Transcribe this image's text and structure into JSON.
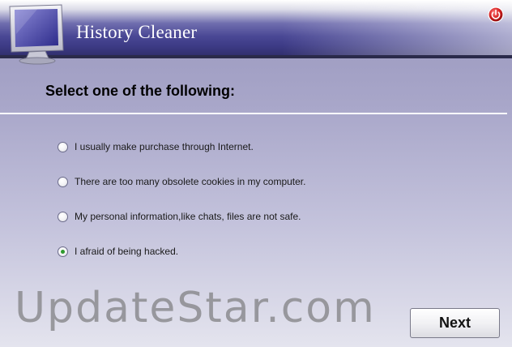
{
  "window": {
    "title": "History Cleaner"
  },
  "icons": {
    "app_icon": "monitor-icon",
    "close_icon": "power-icon"
  },
  "question": {
    "instruction": "Select one of the following:",
    "options": [
      {
        "label": "I usually make purchase through Internet.",
        "selected": false
      },
      {
        "label": "There are too many obsolete cookies in my computer.",
        "selected": false
      },
      {
        "label": "My personal information,like chats, files are not safe.",
        "selected": false
      },
      {
        "label": "I afraid of being hacked.",
        "selected": true
      }
    ]
  },
  "watermark": "UpdateStar.com",
  "footer": {
    "next_label": "Next"
  },
  "colors": {
    "title_bar": "#4a4895",
    "background_top": "#9896bd",
    "background_bottom": "#e4e4ee",
    "radio_selected": "#2f9a2f",
    "close_button": "#d42020"
  }
}
